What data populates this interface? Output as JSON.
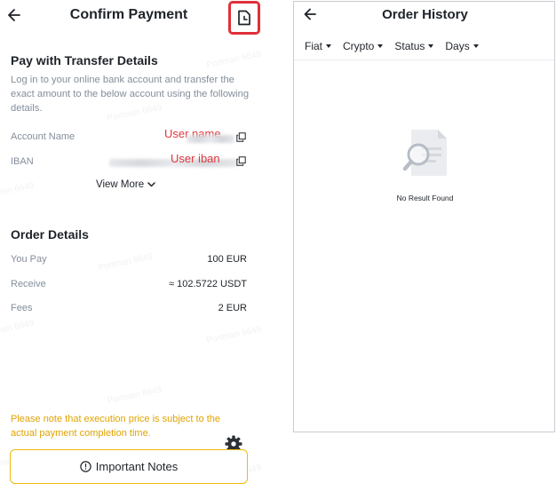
{
  "confirm": {
    "title": "Confirm Payment",
    "transfer": {
      "title": "Pay with Transfer Details",
      "description": "Log in to your online bank account and transfer the exact amount to the below account using the following details."
    },
    "account": {
      "name_label": "Account Name",
      "iban_label": "IBAN",
      "name_annotation": "User name",
      "iban_annotation": "User iban",
      "view_more": "View More"
    },
    "order": {
      "title": "Order Details",
      "rows": [
        {
          "label": "You Pay",
          "value": "100 EUR"
        },
        {
          "label": "Receive",
          "value": "≈ 102.5722 USDT"
        },
        {
          "label": "Fees",
          "value": "2 EUR"
        }
      ]
    },
    "note": "Please note that execution price is subject to the actual payment completion time.",
    "important_notes": "Important Notes",
    "watermark": "Portman 6649",
    "colors": {
      "accent": "#f0b90b",
      "note": "#e0a300",
      "annotation": "#e0393f",
      "highlight": "#e0303a"
    }
  },
  "history": {
    "title": "Order History",
    "filters": [
      "Fiat",
      "Crypto",
      "Status",
      "Days"
    ],
    "empty_text": "No Result Found"
  }
}
